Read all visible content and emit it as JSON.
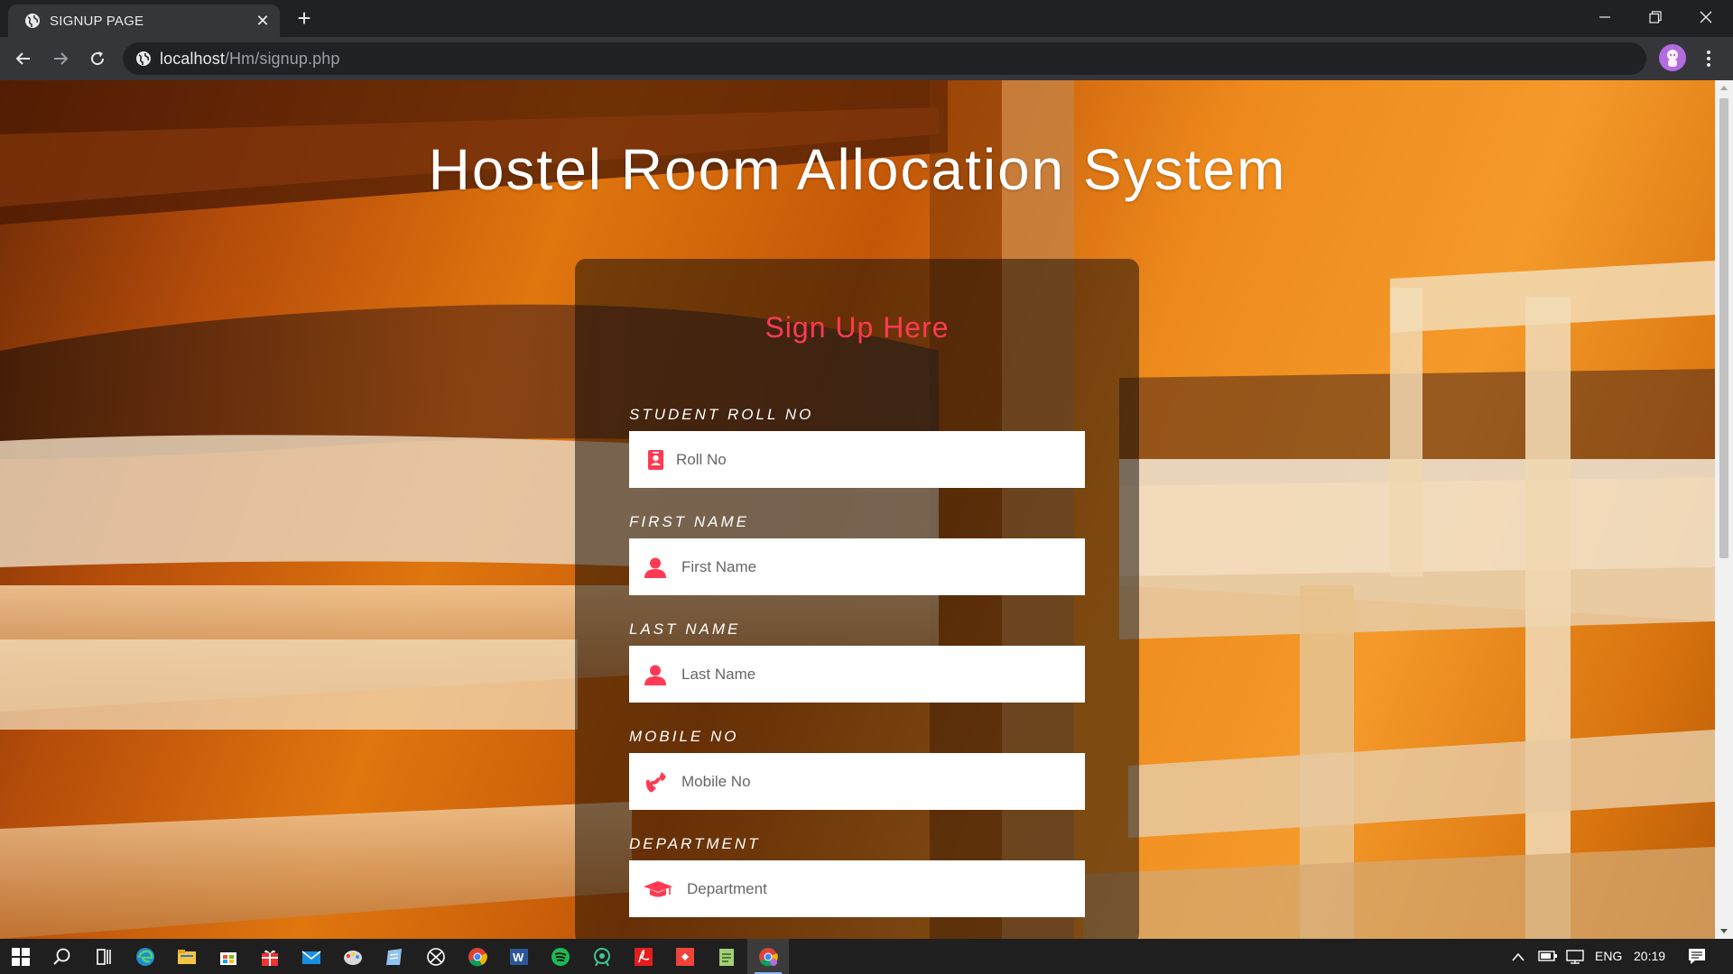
{
  "browser": {
    "tab_title": "SIGNUP PAGE",
    "url_host": "localhost",
    "url_path": "/Hm/signup.php",
    "new_tab_label": "+"
  },
  "page": {
    "title": "Hostel Room Allocation System",
    "form_title": "Sign Up Here",
    "fields": [
      {
        "label": "STUDENT ROLL NO",
        "placeholder": "Roll No",
        "icon": "id-badge-icon"
      },
      {
        "label": "FIRST NAME",
        "placeholder": "First Name",
        "icon": "user-icon"
      },
      {
        "label": "LAST NAME",
        "placeholder": "Last Name",
        "icon": "user-icon"
      },
      {
        "label": "MOBILE NO",
        "placeholder": "Mobile No",
        "icon": "phone-icon"
      },
      {
        "label": "DEPARTMENT",
        "placeholder": "Department",
        "icon": "graduation-cap-icon"
      }
    ]
  },
  "taskbar": {
    "apps": [
      "windows-start-icon",
      "search-icon",
      "task-view-icon",
      "edge-icon",
      "file-explorer-icon",
      "store-icon",
      "gift-app-icon",
      "mail-icon",
      "paint-icon",
      "notes-icon",
      "xbox-icon",
      "chrome-icon",
      "word-icon",
      "spotify-icon",
      "gitkraken-icon",
      "acrobat-icon",
      "anydesk-icon",
      "notepad-icon",
      "chrome-profile-icon"
    ],
    "language": "ENG",
    "time": "20:19"
  },
  "colors": {
    "accent": "#ff3a52",
    "chrome_dark": "#202124",
    "chrome_toolbar": "#35363a"
  }
}
